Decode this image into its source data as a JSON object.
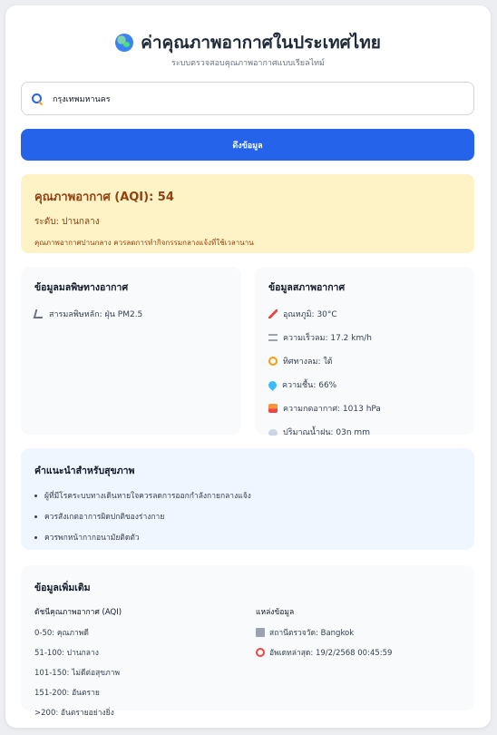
{
  "header": {
    "icon": "globe-icon",
    "title": "ค่าคุณภาพอากาศในประเทศไทย",
    "subtitle": "ระบบตรวจสอบคุณภาพอากาศแบบเรียลไทม์"
  },
  "search": {
    "icon": "search-icon",
    "value": "กรุงเทพมหานคร"
  },
  "fetch_button": {
    "label": "ดึงข้อมูล"
  },
  "aqi": {
    "title": "คุณภาพอากาศ (AQI): 54",
    "level": "ระดับ: ปานกลาง",
    "description": "คุณภาพอากาศปานกลาง ควรลดการทำกิจกรรมกลางแจ้งที่ใช้เวลานาน",
    "background_color": "#fef3c7",
    "text_color": "#92400e"
  },
  "pollution": {
    "title": "ข้อมูลมลพิษทางอากาศ",
    "items": [
      {
        "icon": "microscope-icon",
        "text": "สารมลพิษหลัก: ฝุ่น PM2.5"
      }
    ]
  },
  "weather": {
    "title": "ข้อมูลสภาพอากาศ",
    "items": [
      {
        "icon": "thermometer-icon",
        "text": "อุณหภูมิ: 30°C"
      },
      {
        "icon": "wind-icon",
        "text": "ความเร็วลม: 17.2 km/h"
      },
      {
        "icon": "compass-icon",
        "text": "ทิศทางลม: ใต้"
      },
      {
        "icon": "droplets-icon",
        "text": "ความชื้น: 66%"
      },
      {
        "icon": "sunset-icon",
        "text": "ความกดอากาศ: 1013 hPa"
      },
      {
        "icon": "rain-cloud-icon",
        "text": "ปริมาณน้ำฝน: 03n mm"
      }
    ]
  },
  "health": {
    "title": "คำแนะนำสำหรับสุขภาพ",
    "items": [
      "ผู้ที่มีโรคระบบทางเดินหายใจควรลดการออกกำลังกายกลางแจ้ง",
      "ควรสังเกตอาการผิดปกติของร่างกาย",
      "ควรพกหน้ากากอนามัยติดตัว"
    ]
  },
  "extra": {
    "title": "ข้อมูลเพิ่มเติม",
    "index_head": "ดัชนีคุณภาพอากาศ (AQI)",
    "index_items": [
      "0-50: คุณภาพดี",
      "51-100: ปานกลาง",
      "101-150: ไม่ดีต่อสุขภาพ",
      "151-200: อันตราย",
      ">200: อันตรายอย่างยิ่ง"
    ],
    "source_head": "แหล่งข้อมูล",
    "source_items": [
      {
        "icon": "building-icon",
        "text": "สถานีตรวจวัด: Bangkok"
      },
      {
        "icon": "alarm-clock-icon",
        "text": "อัพเดทล่าสุด: 19/2/2568 00:45:59"
      }
    ]
  },
  "colors": {
    "primary_button": "#2563eb",
    "health_background": "#eff6ff",
    "panel_background": "#f8fafc"
  }
}
